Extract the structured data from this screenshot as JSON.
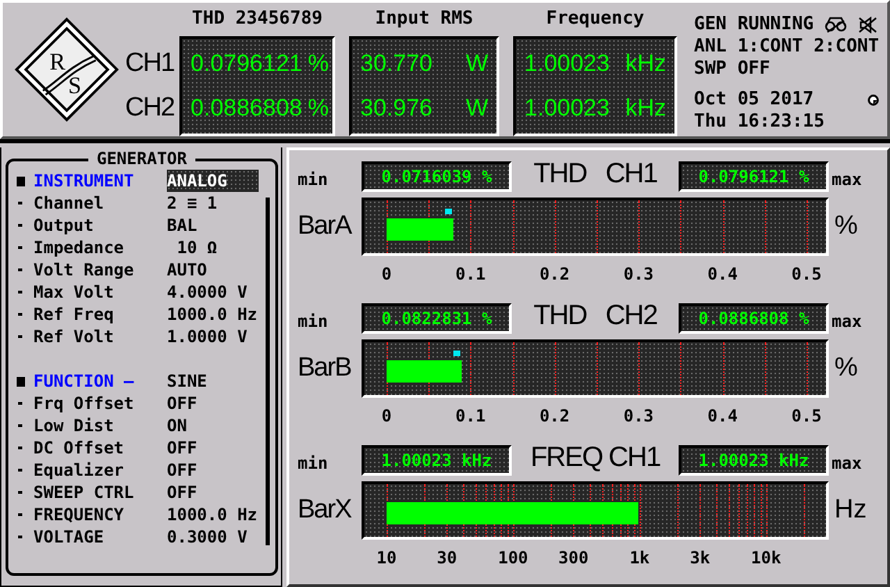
{
  "header": {
    "logo": {
      "letters": [
        "R",
        "S"
      ]
    },
    "channels": [
      "CH1",
      "CH2"
    ],
    "readouts": [
      {
        "title": "THD 23456789",
        "values": [
          {
            "value": "0.0796121",
            "unit": "%"
          },
          {
            "value": "0.0886808",
            "unit": "%"
          }
        ]
      },
      {
        "title": "Input RMS",
        "values": [
          {
            "value": "30.770",
            "unit": "W"
          },
          {
            "value": "30.976",
            "unit": "W"
          }
        ]
      },
      {
        "title": "Frequency",
        "values": [
          {
            "value": "1.00023",
            "unit": "kHz"
          },
          {
            "value": "1.00023",
            "unit": "kHz"
          }
        ]
      }
    ],
    "status": {
      "lines": [
        "GEN RUNNING",
        "ANL 1:CONT 2:CONT",
        "SWP OFF"
      ],
      "date": "Oct 05 2017",
      "time": "Thu 16:23:15"
    }
  },
  "generator": {
    "title": "GENERATOR",
    "sections": [
      {
        "rows": [
          {
            "kind": "header",
            "label": "INSTRUMENT",
            "value": "ANALOG",
            "selected": true
          },
          {
            "kind": "param",
            "label": "Channel",
            "value": "2 ≡ 1",
            "selected": false
          },
          {
            "kind": "param",
            "label": "Output",
            "value": "BAL",
            "selected": false
          },
          {
            "kind": "param",
            "label": "Impedance",
            "value": " 10 Ω",
            "selected": false
          },
          {
            "kind": "param",
            "label": "Volt Range",
            "value": "AUTO",
            "selected": false
          },
          {
            "kind": "param",
            "label": "Max Volt",
            "value": "4.0000 V",
            "selected": false
          },
          {
            "kind": "param",
            "label": "Ref Freq",
            "value": "1000.0 Hz",
            "selected": false
          },
          {
            "kind": "param",
            "label": "Ref Volt",
            "value": "1.0000 V",
            "selected": false
          }
        ]
      },
      {
        "rows": [
          {
            "kind": "header",
            "label": "FUNCTION –",
            "value": "SINE",
            "selected": false
          },
          {
            "kind": "param",
            "label": "Frq Offset",
            "value": "OFF",
            "selected": false
          },
          {
            "kind": "param",
            "label": "Low Dist",
            "value": "ON",
            "selected": false
          },
          {
            "kind": "param",
            "label": "DC Offset",
            "value": "OFF",
            "selected": false
          },
          {
            "kind": "param",
            "label": "Equalizer",
            "value": "OFF",
            "selected": false
          },
          {
            "kind": "param",
            "label": "SWEEP CTRL",
            "value": "OFF",
            "selected": false
          },
          {
            "kind": "param",
            "label": "FREQUENCY",
            "value": "1000.0 Hz",
            "selected": false
          },
          {
            "kind": "param",
            "label": "VOLTAGE",
            "value": "0.3000 V",
            "selected": false
          }
        ]
      }
    ]
  },
  "meters": [
    {
      "name": "BarA",
      "title": "THD   CH1",
      "min_label": "min",
      "min": "0.0716039 %",
      "max_label": "max",
      "max": "0.0796121 %",
      "unit": "%",
      "kind": "linear",
      "level": 0.16,
      "peak": {
        "level": 0.15
      },
      "ticks": [
        "0",
        "0.1",
        "0.2",
        "0.3",
        "0.4",
        "0.5"
      ]
    },
    {
      "name": "BarB",
      "title": "THD   CH2",
      "min_label": "min",
      "min": "0.0822831 %",
      "max_label": "max",
      "max": "0.0886808 %",
      "unit": "%",
      "kind": "linear",
      "level": 0.18,
      "peak": {
        "level": 0.17
      },
      "ticks": [
        "0",
        "0.1",
        "0.2",
        "0.3",
        "0.4",
        "0.5"
      ]
    },
    {
      "name": "BarX",
      "title": "FREQ CH1",
      "min_label": "min",
      "min": "1.00023 kHz",
      "max_label": "max",
      "max": "1.00023 kHz",
      "unit": "Hz",
      "kind": "log",
      "level": 0.6,
      "ticks": [
        "10",
        "30",
        "100",
        "300",
        "1k",
        "3k",
        "10k"
      ]
    }
  ]
}
